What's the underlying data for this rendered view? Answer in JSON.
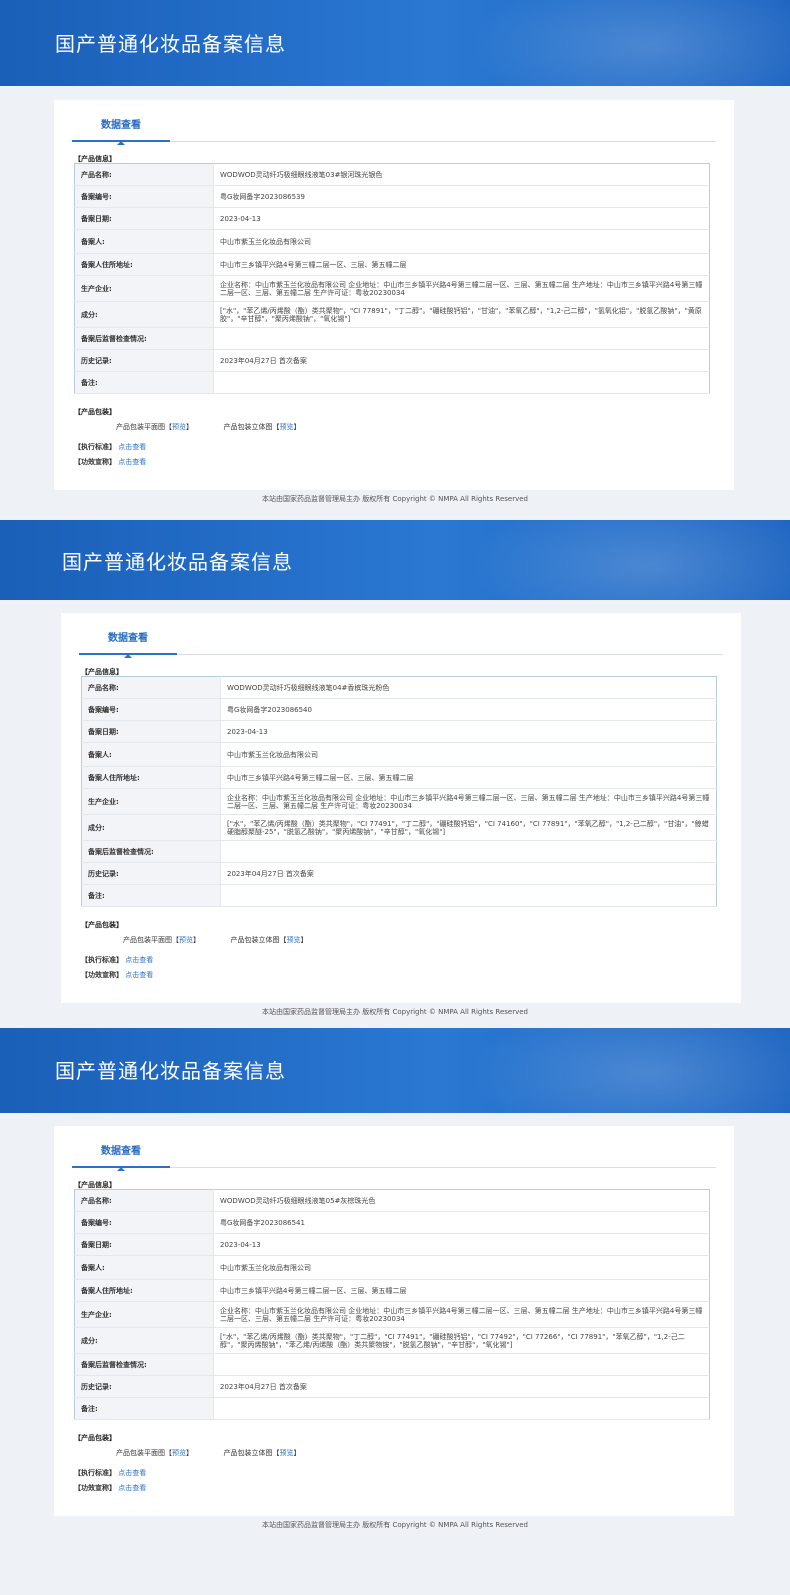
{
  "page_title": "国产普通化妆品备案信息",
  "tab_label": "数据查看",
  "section_product_info": "【产品信息】",
  "section_package": "【产品包装】",
  "section_standard": "【执行标准】",
  "section_efficacy": "【功效宣称】",
  "view_link": "点击查看",
  "package_flat_label": "产品包装平面图",
  "package_3d_label": "产品包装立体图",
  "bracket_open": "【",
  "bracket_close": "】",
  "preview_label": "预览",
  "footer": "本站由国家药品监督管理局主办 版权所有 Copyright © NMPA All Rights Reserved",
  "field_labels": {
    "name": "产品名称:",
    "reg_no": "备案编号:",
    "reg_date": "备案日期:",
    "registrant": "备案人:",
    "address": "备案人住所地址:",
    "manufacturer": "生产企业:",
    "ingredients": "成分:",
    "inspection": "备案后监督检查情况:",
    "history": "历史记录:",
    "remarks": "备注:"
  },
  "records": [
    {
      "name": "WODWOD灵动纤巧极细眼线液笔03#银河珠光银色",
      "reg_no": "粤G妆网备字2023086539",
      "reg_date": "2023-04-13",
      "registrant": "中山市紫玉兰化妆品有限公司",
      "address": "中山市三乡镇平兴路4号第三幢二层一区、三层、第五幢二层",
      "manufacturer": "企业名称：中山市紫玉兰化妆品有限公司 企业地址：中山市三乡镇平兴路4号第三幢二层一区、三层、第五幢二层 生产地址：中山市三乡镇平兴路4号第三幢二层一区、三层、第五幢二层 生产许可证：粤妆20230034",
      "ingredients": "[\"水\"，\"苯乙烯/丙烯酸（酯）类共聚物\"，\"CI 77891\"，\"丁二醇\"，\"硼硅酸钙铝\"，\"甘油\"，\"苯氧乙醇\"，\"1,2-己二醇\"，\"氢氧化铝\"，\"脱氢乙酸钠\"，\"黄原胶\"，\"辛甘醇\"，\"聚丙烯酸钠\"，\"氧化锡\"]",
      "inspection": "",
      "history": "2023年04月27日 首次备案",
      "remarks": ""
    },
    {
      "name": "WODWOD灵动纤巧极细眼线液笔04#香槟珠光粉色",
      "reg_no": "粤G妆网备字2023086540",
      "reg_date": "2023-04-13",
      "registrant": "中山市紫玉兰化妆品有限公司",
      "address": "中山市三乡镇平兴路4号第三幢二层一区、三层、第五幢二层",
      "manufacturer": "企业名称：中山市紫玉兰化妆品有限公司 企业地址：中山市三乡镇平兴路4号第三幢二层一区、三层、第五幢二层 生产地址：中山市三乡镇平兴路4号第三幢二层一区、三层、第五幢二层 生产许可证：粤妆20230034",
      "ingredients": "[\"水\"，\"苯乙烯/丙烯酸（酯）类共聚物\"，\"CI 77491\"，\"丁二醇\"，\"硼硅酸钙铝\"，\"CI 74160\"，\"CI 77891\"，\"苯氧乙醇\"，\"1,2-己二醇\"，\"甘油\"，\"鲸蜡硬脂醇聚醚-25\"，\"脱氢乙酸钠\"，\"聚丙烯酸钠\"，\"辛甘醇\"，\"氧化锡\"]",
      "inspection": "",
      "history": "2023年04月27日 首次备案",
      "remarks": ""
    },
    {
      "name": "WODWOD灵动纤巧极细眼线液笔05#灰棕珠光色",
      "reg_no": "粤G妆网备字2023086541",
      "reg_date": "2023-04-13",
      "registrant": "中山市紫玉兰化妆品有限公司",
      "address": "中山市三乡镇平兴路4号第三幢二层一区、三层、第五幢二层",
      "manufacturer": "企业名称：中山市紫玉兰化妆品有限公司 企业地址：中山市三乡镇平兴路4号第三幢二层一区、三层、第五幢二层 生产地址：中山市三乡镇平兴路4号第三幢二层一区、三层、第五幢二层 生产许可证：粤妆20230034",
      "ingredients": "[\"水\"，\"苯乙烯/丙烯酸（酯）类共聚物\"，\"丁二醇\"，\"CI 77491\"，\"硼硅酸钙铝\"，\"CI 77492\"，\"CI 77266\"，\"CI 77891\"，\"苯氧乙醇\"，\"1,2-己二醇\"，\"聚丙烯酸钠\"，\"苯乙烯/丙烯酸（酯）类共聚物铵\"，\"脱氢乙酸钠\"，\"辛甘醇\"，\"氧化锡\"]",
      "inspection": "",
      "history": "2023年04月27日 首次备案",
      "remarks": ""
    }
  ]
}
